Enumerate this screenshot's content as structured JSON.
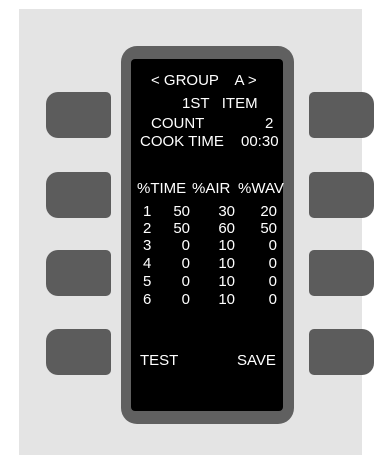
{
  "screen": {
    "group_row": "< GROUP    A >",
    "item_row": "1ST   ITEM",
    "count_label": "COUNT",
    "count_value": "2",
    "cook_time_label": "COOK TIME",
    "cook_time_value": "00:30",
    "headers": [
      "%TIME",
      "%AIR",
      "%WAV"
    ],
    "rows": [
      {
        "stage": "1",
        "time": "50",
        "air": "30",
        "wav": "20"
      },
      {
        "stage": "2",
        "time": "50",
        "air": "60",
        "wav": "50"
      },
      {
        "stage": "3",
        "time": "0",
        "air": "10",
        "wav": "0"
      },
      {
        "stage": "4",
        "time": "0",
        "air": "10",
        "wav": "0"
      },
      {
        "stage": "5",
        "time": "0",
        "air": "10",
        "wav": "0"
      },
      {
        "stage": "6",
        "time": "0",
        "air": "10",
        "wav": "0"
      }
    ],
    "softkey_left": "TEST",
    "softkey_right": "SAVE"
  },
  "colors": {
    "panel": "#e4e4e4",
    "bezel": "#606060",
    "screen": "#000000",
    "button": "#5c5c5c",
    "text": "#ffffff"
  }
}
